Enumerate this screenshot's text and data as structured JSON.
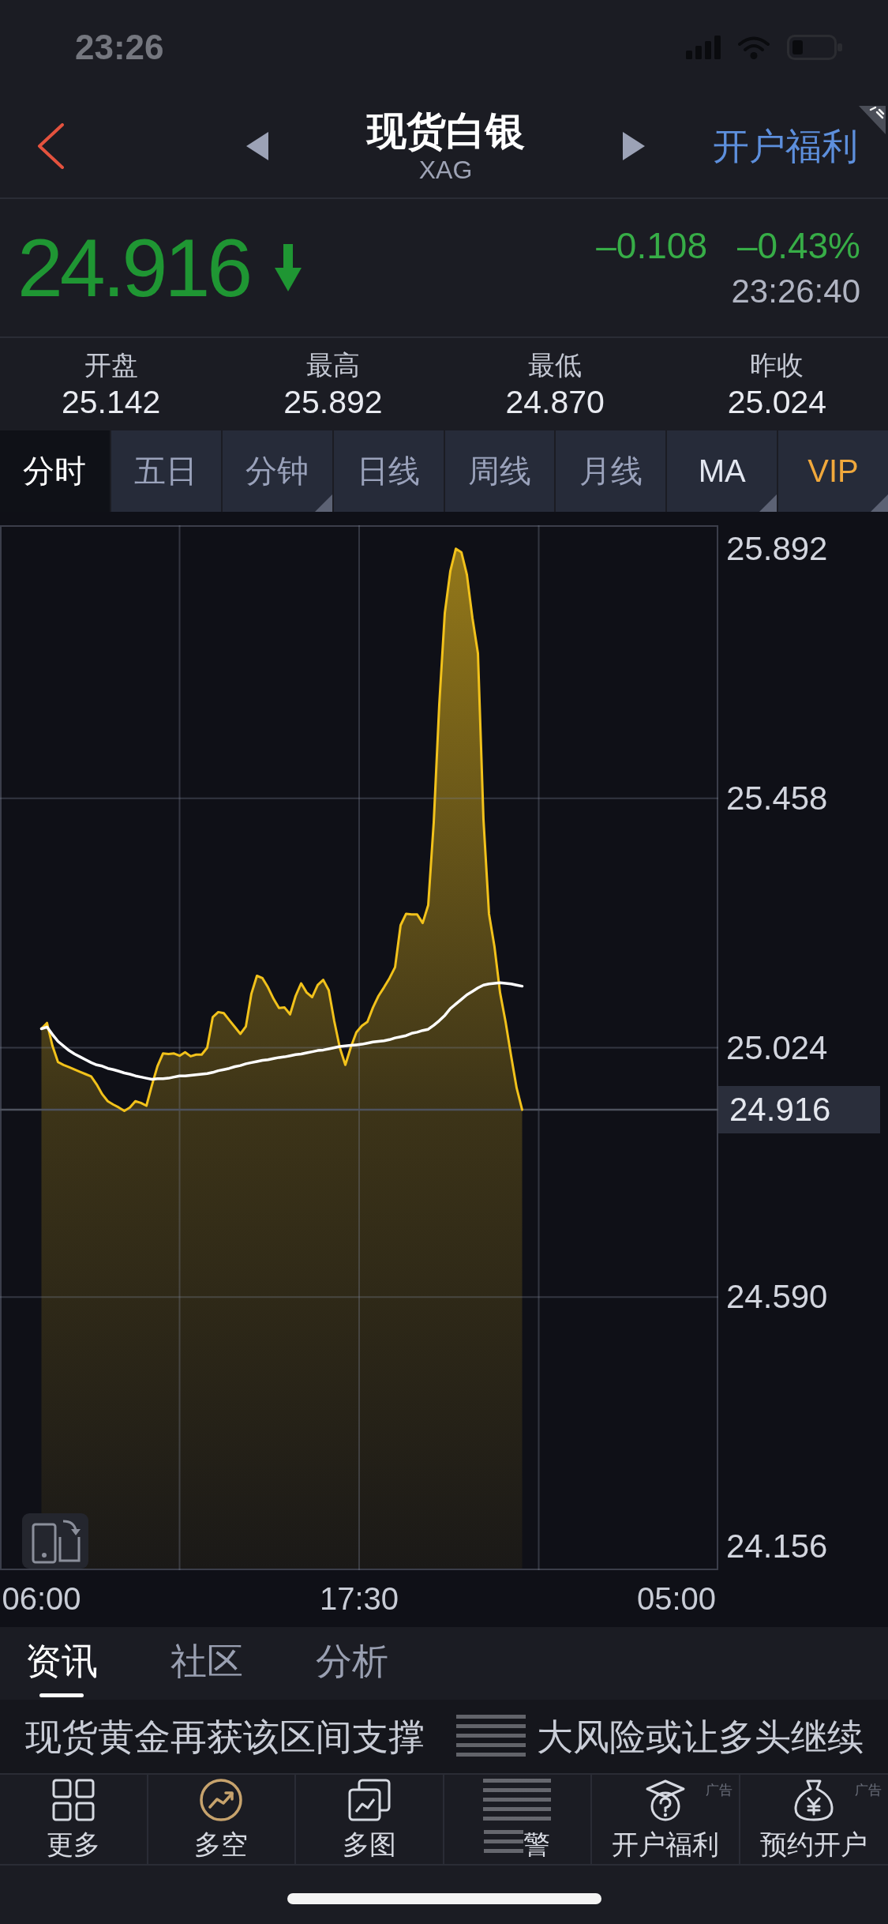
{
  "status_bar": {
    "time": "23:26"
  },
  "nav_bar": {
    "title": "现货白银",
    "subtitle": "XAG",
    "action": "开户福利"
  },
  "quote": {
    "price": "24.916",
    "falling": true,
    "change": "–0.108",
    "change_percent": "–0.43%",
    "time": "23:26:40"
  },
  "stats": [
    {
      "label": "开盘",
      "value": "25.142"
    },
    {
      "label": "最高",
      "value": "25.892"
    },
    {
      "label": "最低",
      "value": "24.870"
    },
    {
      "label": "昨收",
      "value": "25.024"
    }
  ],
  "period_tabs": [
    {
      "label": "分时",
      "kind": "period",
      "selected": true,
      "has_menu": false
    },
    {
      "label": "五日",
      "kind": "period",
      "selected": false,
      "has_menu": false
    },
    {
      "label": "分钟",
      "kind": "period",
      "selected": false,
      "has_menu": true
    },
    {
      "label": "日线",
      "kind": "period",
      "selected": false,
      "has_menu": false
    },
    {
      "label": "周线",
      "kind": "period",
      "selected": false,
      "has_menu": false
    },
    {
      "label": "月线",
      "kind": "period",
      "selected": false,
      "has_menu": false
    },
    {
      "label": "MA",
      "kind": "indicator",
      "selected": false,
      "has_menu": true
    },
    {
      "label": "VIP",
      "kind": "premium",
      "selected": false,
      "has_menu": true
    }
  ],
  "chart": {
    "chart_data": {
      "type": "area",
      "grid": true,
      "x": [
        6.0,
        6.2,
        6.4,
        6.6,
        6.8,
        7.0,
        7.2,
        7.4,
        7.6,
        7.8,
        8.0,
        8.2,
        8.4,
        8.6,
        8.8,
        9.0,
        9.2,
        9.4,
        9.6,
        9.8,
        10.0,
        10.2,
        10.4,
        10.6,
        10.8,
        11.0,
        11.2,
        11.4,
        11.6,
        11.8,
        12.0,
        12.2,
        12.4,
        12.6,
        12.8,
        13.0,
        13.2,
        13.4,
        13.6,
        13.8,
        14.0,
        14.2,
        14.4,
        14.6,
        14.8,
        15.0,
        15.2,
        15.4,
        15.6,
        15.8,
        16.0,
        16.2,
        16.4,
        16.6,
        16.8,
        17.0,
        17.2,
        17.4,
        17.6,
        17.8,
        18.0,
        18.2,
        18.4,
        18.6,
        18.8,
        19.0,
        19.2,
        19.4,
        19.6,
        19.8,
        20.0,
        20.2,
        20.4,
        20.6,
        20.8,
        21.0,
        21.2,
        21.4,
        21.6,
        21.8,
        22.0,
        22.2,
        22.4,
        22.6,
        22.8,
        23.0,
        23.2,
        23.4
      ],
      "series": [
        {
          "color": "#f2c21b",
          "values": [
            25.057,
            25.067,
            25.027,
            24.999,
            24.994,
            24.99,
            24.986,
            24.982,
            24.978,
            24.974,
            24.96,
            24.943,
            24.931,
            24.925,
            24.92,
            24.914,
            24.92,
            24.931,
            24.928,
            24.923,
            24.959,
            24.992,
            25.014,
            25.013,
            25.014,
            25.01,
            25.016,
            25.009,
            25.012,
            25.012,
            25.024,
            25.077,
            25.086,
            25.084,
            25.072,
            25.06,
            25.048,
            25.061,
            25.118,
            25.149,
            25.145,
            25.129,
            25.109,
            25.093,
            25.094,
            25.082,
            25.114,
            25.136,
            25.12,
            25.112,
            25.133,
            25.142,
            25.124,
            25.07,
            25.024,
            24.994,
            25.025,
            25.051,
            25.062,
            25.069,
            25.094,
            25.114,
            25.129,
            25.145,
            25.164,
            25.237,
            25.257,
            25.256,
            25.256,
            25.241,
            25.272,
            25.416,
            25.621,
            25.78,
            25.853,
            25.892,
            25.886,
            25.847,
            25.772,
            25.71,
            25.421,
            25.257,
            25.199,
            25.12,
            25.069,
            25.01,
            24.954,
            24.916
          ]
        },
        {
          "type": "line",
          "color": "#ffffff",
          "values": [
            25.057,
            25.06,
            25.047,
            25.035,
            25.027,
            25.019,
            25.013,
            25.008,
            25.003,
            24.998,
            24.994,
            24.992,
            24.988,
            24.986,
            24.983,
            24.98,
            24.978,
            24.975,
            24.973,
            24.971,
            24.969,
            24.97,
            24.97,
            24.971,
            24.973,
            24.975,
            24.975,
            24.976,
            24.977,
            24.978,
            24.979,
            24.981,
            24.984,
            24.986,
            24.988,
            24.991,
            24.993,
            24.996,
            24.998,
            25.0,
            25.002,
            25.003,
            25.005,
            25.007,
            25.008,
            25.01,
            25.012,
            25.013,
            25.015,
            25.017,
            25.019,
            25.02,
            25.022,
            25.024,
            25.026,
            25.027,
            25.028,
            25.029,
            25.03,
            25.032,
            25.034,
            25.035,
            25.036,
            25.038,
            25.041,
            25.043,
            25.045,
            25.049,
            25.051,
            25.054,
            25.056,
            25.063,
            25.071,
            25.08,
            25.092,
            25.1,
            25.108,
            25.116,
            25.122,
            25.128,
            25.133,
            25.135,
            25.136,
            25.137,
            25.136,
            25.135,
            25.133,
            25.131
          ]
        }
      ],
      "xlim": [
        4.5,
        30.5
      ],
      "ylim": [
        24.115,
        25.933
      ],
      "xticks": [
        {
          "value": 6,
          "label": "06:00"
        },
        {
          "value": 17.5,
          "label": "17:30"
        }
      ],
      "yticks": [
        {
          "value": 25.892,
          "label": "25.892"
        },
        {
          "value": 25.458,
          "label": "25.458"
        },
        {
          "value": 25.024,
          "label": "25.024"
        },
        {
          "value": 24.59,
          "label": "24.590"
        },
        {
          "value": 24.156,
          "label": "24.156"
        }
      ],
      "ref_lines": [
        {
          "axis": "y",
          "value": 24.916,
          "label": "24.916"
        }
      ]
    },
    "session_end_label": "05:00"
  },
  "news_tabs": [
    {
      "label": "资讯",
      "selected": true
    },
    {
      "label": "社区",
      "selected": false
    },
    {
      "label": "分析",
      "selected": false
    }
  ],
  "news": {
    "blurred": true,
    "headline_fragments": [
      "现货黄金再获该区间支撑",
      "大风险或让多头继续"
    ]
  },
  "toolbar": [
    {
      "label": "更多",
      "blurred": false
    },
    {
      "label": "多空",
      "blurred": false
    },
    {
      "label": "多图",
      "blurred": false
    },
    {
      "label": "警",
      "blurred": true
    },
    {
      "label": "开户福利",
      "blurred": false,
      "ad_label": "广告"
    },
    {
      "label": "预约开户",
      "blurred": false,
      "ad_label": "广告"
    }
  ]
}
